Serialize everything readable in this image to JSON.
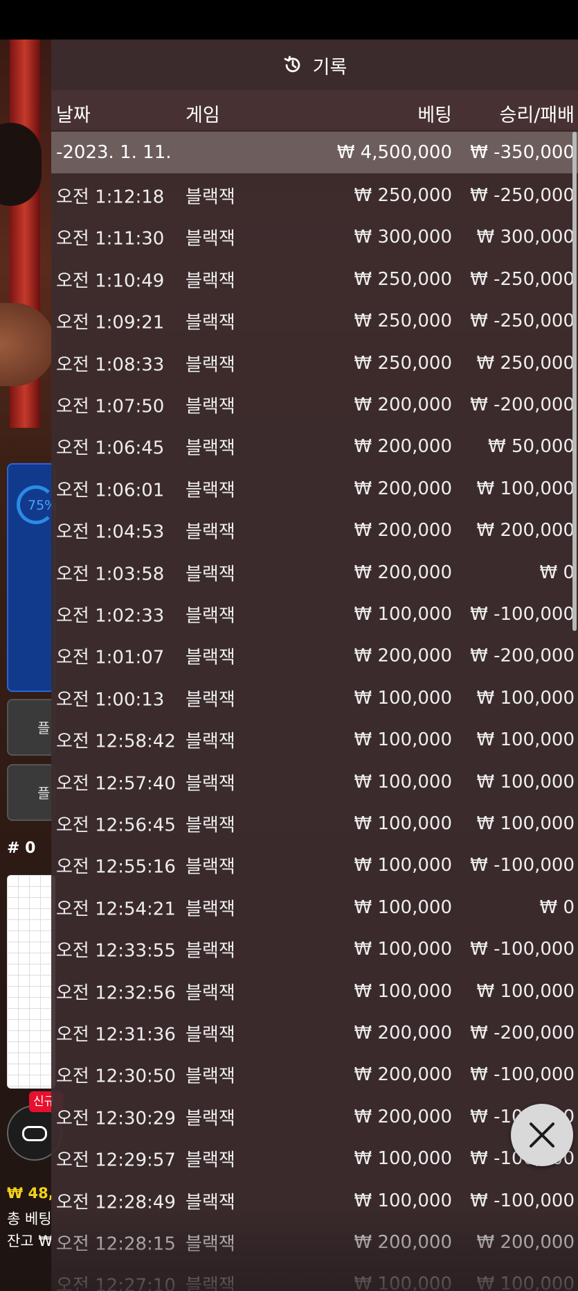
{
  "panel": {
    "title": "기록",
    "icon": "history-icon",
    "columns": {
      "date": "날짜",
      "game": "게임",
      "bet": "베팅",
      "winloss": "승리/패배"
    },
    "date_group": {
      "date": "-2023. 1. 11.",
      "bet_total": "₩ 4,500,000",
      "winloss_total": "₩ -350,000"
    },
    "rows": [
      {
        "time": "오전 1:12:18",
        "game": "블랙잭",
        "bet": "₩ 250,000",
        "winloss": "₩ -250,000"
      },
      {
        "time": "오전 1:11:30",
        "game": "블랙잭",
        "bet": "₩ 300,000",
        "winloss": "₩ 300,000"
      },
      {
        "time": "오전 1:10:49",
        "game": "블랙잭",
        "bet": "₩ 250,000",
        "winloss": "₩ -250,000"
      },
      {
        "time": "오전 1:09:21",
        "game": "블랙잭",
        "bet": "₩ 250,000",
        "winloss": "₩ -250,000"
      },
      {
        "time": "오전 1:08:33",
        "game": "블랙잭",
        "bet": "₩ 250,000",
        "winloss": "₩ 250,000"
      },
      {
        "time": "오전 1:07:50",
        "game": "블랙잭",
        "bet": "₩ 200,000",
        "winloss": "₩ -200,000"
      },
      {
        "time": "오전 1:06:45",
        "game": "블랙잭",
        "bet": "₩ 200,000",
        "winloss": "₩ 50,000"
      },
      {
        "time": "오전 1:06:01",
        "game": "블랙잭",
        "bet": "₩ 200,000",
        "winloss": "₩ 100,000"
      },
      {
        "time": "오전 1:04:53",
        "game": "블랙잭",
        "bet": "₩ 200,000",
        "winloss": "₩ 200,000"
      },
      {
        "time": "오전 1:03:58",
        "game": "블랙잭",
        "bet": "₩ 200,000",
        "winloss": "₩ 0"
      },
      {
        "time": "오전 1:02:33",
        "game": "블랙잭",
        "bet": "₩ 100,000",
        "winloss": "₩ -100,000"
      },
      {
        "time": "오전 1:01:07",
        "game": "블랙잭",
        "bet": "₩ 200,000",
        "winloss": "₩ -200,000"
      },
      {
        "time": "오전 1:00:13",
        "game": "블랙잭",
        "bet": "₩ 100,000",
        "winloss": "₩ 100,000"
      },
      {
        "time": "오전 12:58:42",
        "game": "블랙잭",
        "bet": "₩ 100,000",
        "winloss": "₩ 100,000"
      },
      {
        "time": "오전 12:57:40",
        "game": "블랙잭",
        "bet": "₩ 100,000",
        "winloss": "₩ 100,000"
      },
      {
        "time": "오전 12:56:45",
        "game": "블랙잭",
        "bet": "₩ 100,000",
        "winloss": "₩ 100,000"
      },
      {
        "time": "오전 12:55:16",
        "game": "블랙잭",
        "bet": "₩ 100,000",
        "winloss": "₩ -100,000"
      },
      {
        "time": "오전 12:54:21",
        "game": "블랙잭",
        "bet": "₩ 100,000",
        "winloss": "₩ 0"
      },
      {
        "time": "오전 12:33:55",
        "game": "블랙잭",
        "bet": "₩ 100,000",
        "winloss": "₩ -100,000"
      },
      {
        "time": "오전 12:32:56",
        "game": "블랙잭",
        "bet": "₩ 100,000",
        "winloss": "₩ 100,000"
      },
      {
        "time": "오전 12:31:36",
        "game": "블랙잭",
        "bet": "₩ 200,000",
        "winloss": "₩ -200,000"
      },
      {
        "time": "오전 12:30:50",
        "game": "블랙잭",
        "bet": "₩ 200,000",
        "winloss": "₩ -100,000"
      },
      {
        "time": "오전 12:30:29",
        "game": "블랙잭",
        "bet": "₩ 200,000",
        "winloss": "₩ -100,000"
      },
      {
        "time": "오전 12:29:57",
        "game": "블랙잭",
        "bet": "₩ 100,000",
        "winloss": "₩ -100,000"
      },
      {
        "time": "오전 12:28:49",
        "game": "블랙잭",
        "bet": "₩ 100,000",
        "winloss": "₩ -100,000"
      },
      {
        "time": "오전 12:28:15",
        "game": "블랙잭",
        "bet": "₩ 200,000",
        "winloss": "₩ 200,000"
      },
      {
        "time": "오전 12:27:10",
        "game": "블랙잭",
        "bet": "₩ 100,000",
        "winloss": "₩ 100,000"
      }
    ],
    "close_icon": "close-icon"
  },
  "background": {
    "timer_percent": "75%",
    "hash_label": "# 0",
    "new_badge": "신규",
    "balance_short": "₩ 48,",
    "total_bet_label": "총 베팅",
    "balance_label": "잔고 ₩"
  }
}
